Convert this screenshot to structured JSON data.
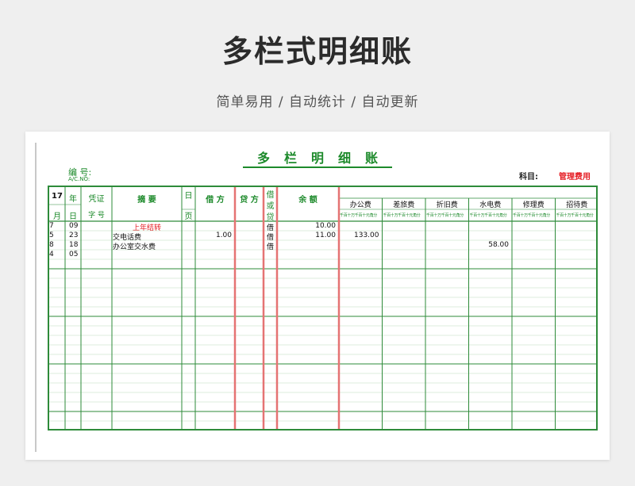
{
  "banner": {
    "title": "多栏式明细账",
    "subtitle": "简单易用 / 自动统计 / 自动更新"
  },
  "ledger": {
    "title": "多栏明细账",
    "account_label": "编 号:",
    "account_en": "A/C.NO:",
    "subject_label": "科目:",
    "subject_value": "管理费用",
    "colors": {
      "green": "#2e8b3a",
      "red_rule": "#e57373",
      "red_text": "#e51c23"
    },
    "headers": {
      "year": "17",
      "year_suffix": "年",
      "month": "月",
      "day": "日",
      "voucher": "凭证",
      "voucher_no": "字 号",
      "summary": "摘 要",
      "page_top": "日",
      "page_bottom": "页",
      "debit": "借 方",
      "credit": "贷 方",
      "dir1": "借",
      "dir2": "或",
      "dir3": "贷",
      "balance": "余 额",
      "digit_units": "千百十万千百十元角分"
    },
    "categories": [
      "办公费",
      "差旅费",
      "折旧费",
      "水电费",
      "修理费",
      "招待费"
    ],
    "rows": [
      {
        "month": "7",
        "day": "09",
        "summary": "上年结转",
        "debit": "",
        "dir": "借",
        "balance": "10.00",
        "cats": [
          "",
          "",
          "",
          "",
          "",
          ""
        ],
        "highlight": true
      },
      {
        "month": "5",
        "day": "23",
        "summary": "交电话费",
        "debit": "1.00",
        "dir": "借",
        "balance": "11.00",
        "cats": [
          "133.00",
          "",
          "",
          "",
          "",
          ""
        ],
        "highlight": false
      },
      {
        "month": "8",
        "day": "18",
        "summary": "办公室交水费",
        "debit": "",
        "dir": "借",
        "balance": "",
        "cats": [
          "",
          "",
          "",
          "58.00",
          "",
          ""
        ],
        "highlight": false
      },
      {
        "month": "4",
        "day": "05",
        "summary": "",
        "debit": "",
        "dir": "",
        "balance": "",
        "cats": [
          "",
          "",
          "",
          "",
          "",
          ""
        ],
        "highlight": false
      }
    ]
  }
}
